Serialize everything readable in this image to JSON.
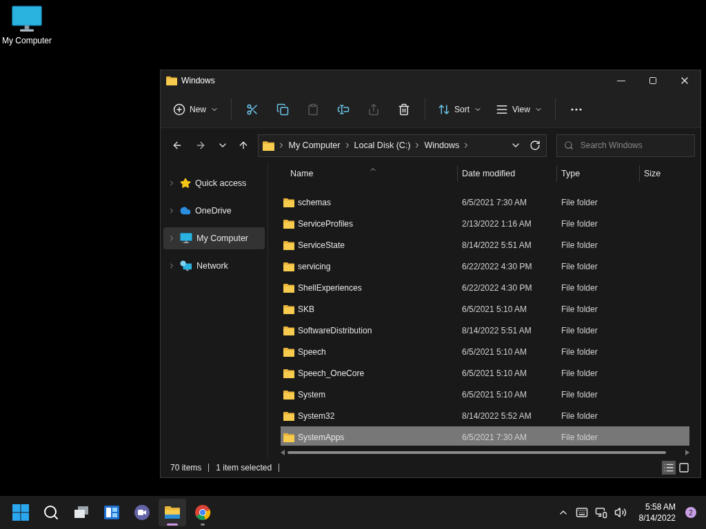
{
  "desktop_icons": [
    {
      "label": "My Computer"
    }
  ],
  "window": {
    "title": "Windows"
  },
  "toolbar": [
    {
      "kind": "new",
      "label": "New",
      "disabled": false
    },
    {
      "kind": "cut",
      "disabled": false
    },
    {
      "kind": "copy",
      "disabled": false
    },
    {
      "kind": "paste",
      "disabled": true
    },
    {
      "kind": "rename",
      "disabled": false
    },
    {
      "kind": "share",
      "disabled": true
    },
    {
      "kind": "delete",
      "disabled": false
    },
    {
      "kind": "sort",
      "label": "Sort",
      "disabled": false
    },
    {
      "kind": "view",
      "label": "View",
      "disabled": false
    },
    {
      "kind": "more",
      "disabled": false
    }
  ],
  "address": {
    "path": [
      "My Computer",
      "Local Disk (C:)",
      "Windows"
    ],
    "search_placeholder": "Search Windows"
  },
  "sidebar": {
    "items": [
      {
        "kind": "star",
        "label": "Quick access",
        "selected": false
      },
      {
        "kind": "cloud",
        "label": "OneDrive",
        "selected": false
      },
      {
        "kind": "computer",
        "label": "My Computer",
        "selected": true
      },
      {
        "kind": "network",
        "label": "Network",
        "selected": false
      }
    ]
  },
  "table": {
    "columns": [
      "Name",
      "Date modified",
      "Type",
      "Size"
    ],
    "rows": [
      {
        "name": "schemas",
        "date": "6/5/2021 7:30 AM",
        "type": "File folder",
        "selected": false
      },
      {
        "name": "ServiceProfiles",
        "date": "2/13/2022 1:16 AM",
        "type": "File folder",
        "selected": false
      },
      {
        "name": "ServiceState",
        "date": "8/14/2022 5:51 AM",
        "type": "File folder",
        "selected": false
      },
      {
        "name": "servicing",
        "date": "6/22/2022 4:30 PM",
        "type": "File folder",
        "selected": false
      },
      {
        "name": "ShellExperiences",
        "date": "6/22/2022 4:30 PM",
        "type": "File folder",
        "selected": false
      },
      {
        "name": "SKB",
        "date": "6/5/2021 5:10 AM",
        "type": "File folder",
        "selected": false
      },
      {
        "name": "SoftwareDistribution",
        "date": "8/14/2022 5:51 AM",
        "type": "File folder",
        "selected": false
      },
      {
        "name": "Speech",
        "date": "6/5/2021 5:10 AM",
        "type": "File folder",
        "selected": false
      },
      {
        "name": "Speech_OneCore",
        "date": "6/5/2021 5:10 AM",
        "type": "File folder",
        "selected": false
      },
      {
        "name": "System",
        "date": "6/5/2021 5:10 AM",
        "type": "File folder",
        "selected": false
      },
      {
        "name": "System32",
        "date": "8/14/2022 5:52 AM",
        "type": "File folder",
        "selected": false
      },
      {
        "name": "SystemApps",
        "date": "6/5/2021 7:30 AM",
        "type": "File folder",
        "selected": true
      }
    ]
  },
  "status_bar": {
    "count": "70 items",
    "selection": "1 item selected",
    "views": [
      {
        "kind": "details",
        "selected": true
      },
      {
        "kind": "tiles",
        "selected": false
      }
    ]
  },
  "taskbar": {
    "apps": [
      {
        "kind": "start",
        "active": false,
        "running": false
      },
      {
        "kind": "search",
        "active": false,
        "running": false
      },
      {
        "kind": "taskview",
        "active": false,
        "running": false
      },
      {
        "kind": "widgets",
        "active": false,
        "running": false
      },
      {
        "kind": "chat",
        "active": false,
        "running": false
      },
      {
        "kind": "explorer",
        "active": true,
        "running": true
      },
      {
        "kind": "chrome",
        "active": false,
        "running": true
      }
    ],
    "time": "5:58 AM",
    "date": "8/14/2022",
    "notifications": "2"
  }
}
